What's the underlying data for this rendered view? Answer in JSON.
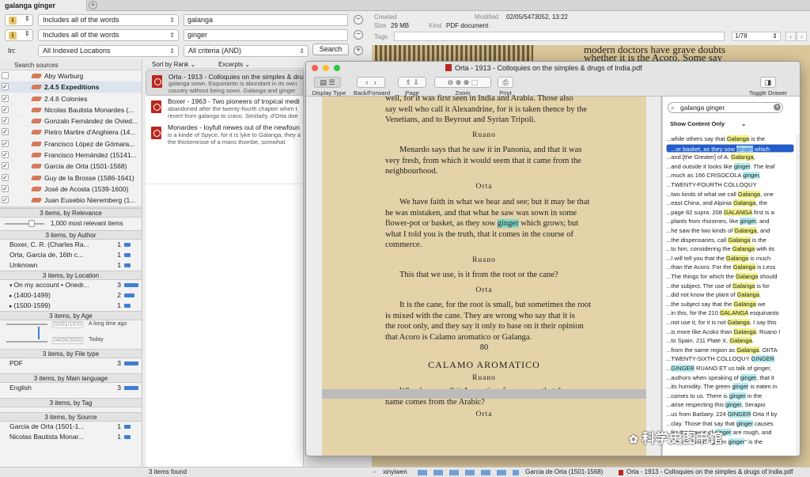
{
  "tab": {
    "title": "galanga ginger"
  },
  "criteria": [
    {
      "mode": "Includes all of the words",
      "term": "galanga"
    },
    {
      "mode": "Includes all of the words",
      "term": "ginger"
    }
  ],
  "scope": {
    "in_label": "In:",
    "location": "All Indexed Locations",
    "criteria": "All criteria (AND)",
    "search_label": "Search"
  },
  "sources": {
    "header": "Search sources",
    "items": [
      {
        "label": "Aby Warburg",
        "checked": false
      },
      {
        "label": "2.4.5 Expeditions",
        "checked": true
      },
      {
        "label": "2.4.6 Colonies",
        "checked": true
      },
      {
        "label": "Nicolas Bautista Monardes (...",
        "checked": true
      },
      {
        "label": "Gonzalo Fernández de Ovied...",
        "checked": true
      },
      {
        "label": "Pietro Martire d'Anghiera (14...",
        "checked": true
      },
      {
        "label": "Francisco López de Gómara...",
        "checked": true
      },
      {
        "label": "Francisco Hernández (15141...",
        "checked": true
      },
      {
        "label": "Garcia de Orta (1501-1568)",
        "checked": true
      },
      {
        "label": "Guy de la Brosse (1586-1641)",
        "checked": true
      },
      {
        "label": "José de Acosta (1539-1600)",
        "checked": true
      },
      {
        "label": "Juan Eusebio Nieremberg (1...",
        "checked": true
      }
    ]
  },
  "facets": {
    "relevance": {
      "header": "3 items, by Relevance",
      "label": "1,000 most relevant items"
    },
    "author": {
      "header": "3 items, by Author",
      "rows": [
        {
          "label": "Boxer, C. R. (Charles Ra...",
          "count": "1",
          "frac": 0.33
        },
        {
          "label": "Orta, Garcia de, 16th c...",
          "count": "1",
          "frac": 0.33
        },
        {
          "label": "Unknown",
          "count": "1",
          "frac": 0.33
        }
      ]
    },
    "location": {
      "header": "3 items, by Location",
      "rows": [
        {
          "label": "On my account • Onedr...",
          "count": "3",
          "frac": 1
        },
        {
          "label": "(1400-1499)",
          "count": "2",
          "frac": 0.67
        },
        {
          "label": "(1500-1599)",
          "count": "1",
          "frac": 0.33
        }
      ]
    },
    "age": {
      "header": "3 items, by Age",
      "from": "01/01/1970",
      "from_label": "A long time ago",
      "to": "04/06/2020",
      "to_label": "Today"
    },
    "filetype": {
      "header": "3 items, by File type",
      "rows": [
        {
          "label": "PDF",
          "count": "3",
          "frac": 1
        }
      ]
    },
    "language": {
      "header": "3 items, by Main language",
      "rows": [
        {
          "label": "English",
          "count": "3",
          "frac": 1
        }
      ]
    },
    "tag": {
      "header": "3 items, by Tag"
    },
    "source": {
      "header": "3 items, by Source",
      "rows": [
        {
          "label": "Garcia de Orta (1501-1...",
          "count": "1",
          "frac": 0.33
        },
        {
          "label": "Nicolas Bautista Monar...",
          "count": "1",
          "frac": 0.33
        }
      ]
    }
  },
  "results_head": {
    "sort": "Sort by Rank",
    "excerpts": "Excerpts"
  },
  "results": [
    {
      "title": "Orta - 1913 - Colloquies on the simples & drug",
      "snip1": "galanga sown. Esquinanto is abundant in its own",
      "snip2": "country without being sown. Galanga and ginger"
    },
    {
      "title": "Boxer - 1963 - Two pioneers of tropical medi",
      "snip1": "abandoned after the twenty-fourth chapter when t",
      "snip2": "revert from galanga to cravo. Similarly, d'Orta doe"
    },
    {
      "title": "Monardes - Ioyfull newes out of the newfoun",
      "snip1": "is a kinde of Spyce, for it is lyke to Galanga, they a",
      "snip2": "the thickenesse of a mans thombe, somwhat"
    }
  ],
  "found": "3 items found",
  "info": {
    "created_label": "Created",
    "modified_label": "Modified",
    "modified": "02/05/5473052, 13:22",
    "size_label": "Size",
    "size": "29 MB",
    "kind_label": "Kind",
    "kind": "PDF document",
    "tags_label": "Tags",
    "page": "1/78"
  },
  "bgtext": [
    "modern doctors have grave doubts",
    "whether it is the Acoro. Some say"
  ],
  "preview": {
    "title": "Orta - 1913 - Colloquies on the simples & drugs of India.pdf",
    "tools": {
      "display": "Display Type",
      "nav": "Back/Forward",
      "page": "Page",
      "zoom": "Zoom",
      "print": "Print",
      "drawer": "Toggle Drawer"
    },
    "lines": [
      "well, for it was first seen in India and Arabia.  Those also",
      "say well who call it Alexandrine, for it is taken thence by the",
      "Venetians, and to Beyrout and Syrian Tripoli.",
      "Ruano",
      "Menardo says that he saw it in Panonia, and that it was",
      "very fresh, from which it would seem that it came from the",
      "neighbourhood.",
      "Orta",
      "We have faith in what we hear and see; but it may be that",
      "he was mistaken, and that what he saw was sown in some",
      "flower-pot or basket, as they sow ginger which grows; but",
      "what I told you is the truth, that it comes in the course of",
      "commerce.",
      "Ruano",
      "This that we use, is it from the root or the cane?",
      "Orta",
      "It is the cane, for the root is small, but sometimes the root",
      "is mixed with the cane.  They are wrong who say that it is",
      "the root only, and they say it only to base on it their opinion",
      "that Acoro is Calamo aromatico or Galanga.",
      "80",
      "CALAMO AROMATICO",
      "Ruano",
      "Why do you call it Aromatico, for you say that the",
      "name comes from the Arabic?",
      "Orta"
    ],
    "search": "galanga ginger",
    "content_mode": "Show Content Only",
    "hits": [
      [
        "...while others say that ",
        "Galanga",
        " is the"
      ],
      [
        "...or basket, as they sow ",
        "ginger",
        " which"
      ],
      [
        "...and [the Greater] of A. ",
        "Galanga",
        ","
      ],
      [
        "...and outside it looks like ",
        "ginger",
        ". The leaf"
      ],
      [
        "...much as 166 CRISOCOLA ",
        "ginger",
        ","
      ],
      [
        "...TWENTY-FOURTH COLLOQUY",
        "",
        ""
      ],
      [
        "...two kinds of what we call ",
        "Galanga",
        ", one"
      ],
      [
        "...east China, and Alpinia ",
        "Galanga",
        ", the"
      ],
      [
        "...page 82 supra. 208 ",
        "GALANGA",
        " first is a"
      ],
      [
        "...plants from rhizomes, like ",
        "ginger",
        ", and"
      ],
      [
        "...he saw the two kinds of ",
        "Galanga",
        ", and"
      ],
      [
        "...the dispensaries, call ",
        "Galanga",
        " is the"
      ],
      [
        "...to him, considering the ",
        "Galanga",
        " with its"
      ],
      [
        "...I will tell you that the ",
        "Galanga",
        " is much"
      ],
      [
        "...than the Acoro. For the ",
        "Galanga",
        " is Less"
      ],
      [
        "...The things for which the ",
        "Galanga",
        " should"
      ],
      [
        "...the subject. The use of ",
        "Galanga",
        " is for"
      ],
      [
        "...did not know the plant of ",
        "Galanga",
        "."
      ],
      [
        "...the subject say that the ",
        "Galanga",
        " we"
      ],
      [
        "...in this, for the 210 ",
        "GALANGA",
        " esquinanto"
      ],
      [
        "...not use it, for it is not ",
        "Galanga",
        ". I say this"
      ],
      [
        "...is more like Acoko than ",
        "Galanga",
        ". Ruano I"
      ],
      [
        "...to Spain. 211 Plate X. ",
        "Galanga",
        "."
      ],
      [
        "...from the same region as ",
        "Galanga",
        ". OIITA"
      ],
      [
        "...TWENTY-SIXTH COLLOQUY ",
        "GINGER",
        ""
      ],
      [
        "...",
        "GINGER",
        " RUANO ET us talk of ginger,"
      ],
      [
        "...authors when speaking of ",
        "ginger",
        ", that it"
      ],
      [
        "...its humidity. The green ",
        "ginger",
        " is eaten in"
      ],
      [
        "...comes to us. There is ",
        "ginger",
        " in the"
      ],
      [
        "...arise respecting this ",
        "ginger",
        ", Serapio"
      ],
      [
        "...us from Barbary. 224 ",
        "GINGER",
        " Orta If by"
      ],
      [
        "...clay. Those that say that ",
        "ginger",
        " causes"
      ],
      [
        "...for the leaves of ",
        "ginger",
        " are rough, and"
      ],
      [
        "...the 'monsoon' \"green ",
        "ginger",
        "\" is the"
      ]
    ]
  },
  "bottom": {
    "user": "xinyiwen",
    "crumb": "Garcia de Orta (1501-1568)",
    "file": "Orta - 1913 - Colloquies on the simples & drugs of India.pdf"
  },
  "watermark": "科学史图书馆",
  "colors": {
    "accent": "#1f5dd0",
    "bar": "#3f7ed3",
    "pdf": "#b82a20",
    "hit_yellow": "#f2f28a",
    "hit_cyan": "#b5ecf0"
  }
}
